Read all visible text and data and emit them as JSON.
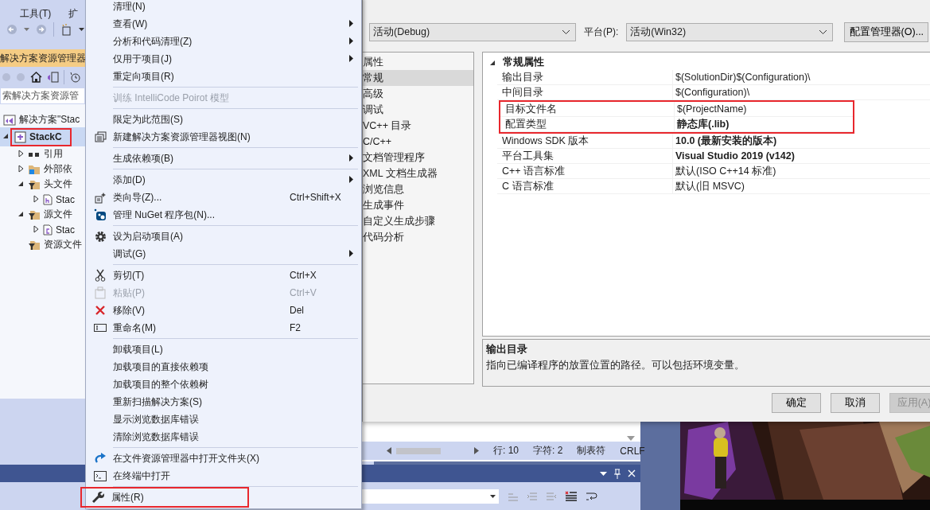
{
  "vs_menu_bar": [
    {
      "label": "工具(T)"
    },
    {
      "label": "扩"
    }
  ],
  "solution_explorer": {
    "title": "解决方案资源管理器",
    "search": {
      "placeholder": "索解决方案资源管"
    },
    "tree": [
      {
        "label": "解决方案\"Stac",
        "kind": "solution",
        "selected": false,
        "highlighted": false,
        "children": [
          {
            "label": "StackC",
            "kind": "project",
            "selected": true,
            "highlighted": true,
            "expanded": true,
            "children": [
              {
                "label": "引用",
                "kind": "references",
                "selected": false,
                "highlighted": false,
                "expanded": false
              },
              {
                "label": "外部依",
                "kind": "external",
                "selected": false,
                "highlighted": false,
                "expanded": false
              },
              {
                "label": "头文件",
                "kind": "filter",
                "selected": false,
                "highlighted": false,
                "expanded": true,
                "children": [
                  {
                    "label": "Stac",
                    "kind": "header",
                    "selected": false,
                    "highlighted": false,
                    "expanded": false
                  }
                ]
              },
              {
                "label": "源文件",
                "kind": "filter",
                "selected": false,
                "highlighted": false,
                "expanded": true,
                "children": [
                  {
                    "label": "Stac",
                    "kind": "source",
                    "selected": false,
                    "highlighted": false,
                    "expanded": false
                  }
                ]
              },
              {
                "label": "资源文件",
                "kind": "filter",
                "selected": false,
                "highlighted": false
              }
            ]
          }
        ]
      }
    ]
  },
  "context_menu": {
    "items": [
      {
        "kind": "item",
        "label": "清理(N)",
        "disabled": false,
        "submenu": false,
        "highlighted": false
      },
      {
        "kind": "item",
        "label": "查看(W)",
        "disabled": false,
        "submenu": true,
        "highlighted": false
      },
      {
        "kind": "item",
        "label": "分析和代码清理(Z)",
        "disabled": false,
        "submenu": true,
        "highlighted": false
      },
      {
        "kind": "item",
        "label": "仅用于项目(J)",
        "disabled": false,
        "submenu": true,
        "highlighted": false
      },
      {
        "kind": "item",
        "label": "重定向项目(R)",
        "disabled": false,
        "submenu": false,
        "highlighted": false
      },
      {
        "kind": "separator"
      },
      {
        "kind": "item",
        "label": "训练 IntelliCode Poirot 模型",
        "disabled": true,
        "submenu": false,
        "highlighted": false
      },
      {
        "kind": "separator"
      },
      {
        "kind": "item",
        "label": "限定为此范围(S)",
        "disabled": false,
        "submenu": false,
        "highlighted": false
      },
      {
        "kind": "item",
        "label": "新建解决方案资源管理器视图(N)",
        "disabled": false,
        "submenu": false,
        "highlighted": false
      },
      {
        "kind": "separator"
      },
      {
        "kind": "item",
        "label": "生成依赖项(B)",
        "disabled": false,
        "submenu": true,
        "highlighted": false
      },
      {
        "kind": "separator"
      },
      {
        "kind": "item",
        "label": "添加(D)",
        "disabled": false,
        "submenu": true,
        "highlighted": false
      },
      {
        "kind": "item",
        "label": "类向导(Z)...",
        "shortcut": "Ctrl+Shift+X",
        "disabled": false,
        "submenu": false,
        "highlighted": false
      },
      {
        "kind": "item",
        "label": "管理 NuGet 程序包(N)...",
        "disabled": false,
        "submenu": false,
        "highlighted": false
      },
      {
        "kind": "separator"
      },
      {
        "kind": "item",
        "label": "设为启动项目(A)",
        "disabled": false,
        "submenu": false,
        "highlighted": false
      },
      {
        "kind": "item",
        "label": "调试(G)",
        "disabled": false,
        "submenu": true,
        "highlighted": false
      },
      {
        "kind": "separator"
      },
      {
        "kind": "item",
        "label": "剪切(T)",
        "shortcut": "Ctrl+X",
        "disabled": false,
        "submenu": false,
        "highlighted": false
      },
      {
        "kind": "item",
        "label": "粘贴(P)",
        "shortcut": "Ctrl+V",
        "disabled": true,
        "submenu": false,
        "highlighted": false
      },
      {
        "kind": "item",
        "label": "移除(V)",
        "shortcut": "Del",
        "disabled": false,
        "submenu": false,
        "highlighted": false
      },
      {
        "kind": "item",
        "label": "重命名(M)",
        "shortcut": "F2",
        "disabled": false,
        "submenu": false,
        "highlighted": false
      },
      {
        "kind": "separator"
      },
      {
        "kind": "item",
        "label": "卸载项目(L)",
        "disabled": false,
        "submenu": false,
        "highlighted": false
      },
      {
        "kind": "item",
        "label": "加载项目的直接依赖项",
        "disabled": false,
        "submenu": false,
        "highlighted": false
      },
      {
        "kind": "item",
        "label": "加载项目的整个依赖树",
        "disabled": false,
        "submenu": false,
        "highlighted": false
      },
      {
        "kind": "item",
        "label": "重新扫描解决方案(S)",
        "disabled": false,
        "submenu": false,
        "highlighted": false
      },
      {
        "kind": "item",
        "label": "显示浏览数据库错误",
        "disabled": false,
        "submenu": false,
        "highlighted": false
      },
      {
        "kind": "item",
        "label": "清除浏览数据库错误",
        "disabled": false,
        "submenu": false,
        "highlighted": false
      },
      {
        "kind": "separator"
      },
      {
        "kind": "item",
        "label": "在文件资源管理器中打开文件夹(X)",
        "disabled": false,
        "submenu": false,
        "highlighted": false
      },
      {
        "kind": "item",
        "label": "在终端中打开",
        "disabled": false,
        "submenu": false,
        "highlighted": false
      },
      {
        "kind": "separator"
      },
      {
        "kind": "item",
        "label": "属性(R)",
        "disabled": false,
        "submenu": false,
        "highlighted": true
      }
    ]
  },
  "property_dialog": {
    "configuration": "活动(Debug)",
    "platform_label": "平台(P):",
    "platform": "活动(Win32)",
    "config_manager_button": "配置管理器(O)...",
    "nav": [
      {
        "label": "属性",
        "selected": false
      },
      {
        "label": "常规",
        "selected": true
      },
      {
        "label": "高级",
        "selected": false
      },
      {
        "label": "调试",
        "selected": false
      },
      {
        "label": "VC++ 目录",
        "selected": false
      },
      {
        "label": "C/C++",
        "selected": false
      },
      {
        "label": "文档管理程序",
        "selected": false
      },
      {
        "label": "XML 文档生成器",
        "selected": false
      },
      {
        "label": "浏览信息",
        "selected": false
      },
      {
        "label": "生成事件",
        "selected": false
      },
      {
        "label": "自定义生成步骤",
        "selected": false
      },
      {
        "label": "代码分析",
        "selected": false
      }
    ],
    "category": {
      "label": "常规属性",
      "expanded": true
    },
    "properties": [
      {
        "name": "输出目录",
        "value": "$(SolutionDir)$(Configuration)\\",
        "modified": false,
        "highlighted": false
      },
      {
        "name": "中间目录",
        "value": "$(Configuration)\\",
        "modified": false,
        "highlighted": false
      },
      {
        "name": "目标文件名",
        "value": "$(ProjectName)",
        "modified": false,
        "highlighted": true
      },
      {
        "name": "配置类型",
        "value": "静态库(.lib)",
        "modified": true,
        "highlighted": true
      },
      {
        "name": "Windows SDK 版本",
        "value": "10.0 (最新安装的版本)",
        "modified": true,
        "highlighted": false
      },
      {
        "name": "平台工具集",
        "value": "Visual Studio 2019 (v142)",
        "modified": true,
        "highlighted": false
      },
      {
        "name": "C++ 语言标准",
        "value": "默认(ISO C++14 标准)",
        "modified": false,
        "highlighted": false
      },
      {
        "name": "C 语言标准",
        "value": "默认(旧 MSVC)",
        "modified": false,
        "highlighted": false
      }
    ],
    "description": {
      "title": "输出目录",
      "text": "指向已编译程序的放置位置的路径。可以包括环境变量。"
    },
    "buttons": [
      {
        "label": "确定",
        "disabled": false
      },
      {
        "label": "取消",
        "disabled": false
      },
      {
        "label": "应用(A)",
        "disabled": true
      }
    ]
  },
  "status_bar": {
    "line": "行: 10",
    "column": "字符: 2",
    "indent": "制表符",
    "line_ending": "CRLF"
  }
}
